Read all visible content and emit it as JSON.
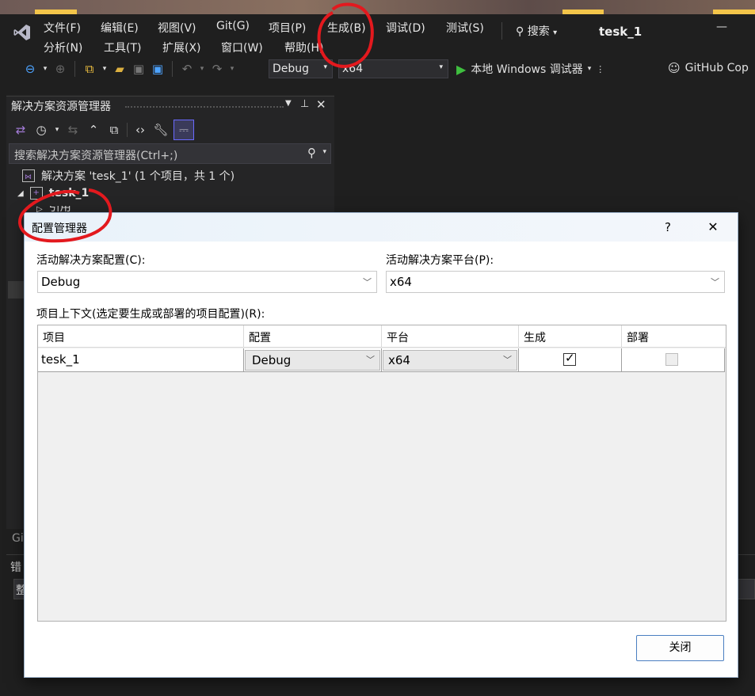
{
  "menu": {
    "row1": [
      "文件(F)",
      "编辑(E)",
      "视图(V)",
      "Git(G)",
      "项目(P)",
      "生成(B)",
      "调试(D)",
      "测试(S)"
    ],
    "row2": [
      "分析(N)",
      "工具(T)",
      "扩展(X)",
      "窗口(W)",
      "帮助(H)"
    ],
    "search_label": "搜索",
    "window_title": "tesk_1",
    "minimize": "—"
  },
  "toolbar": {
    "config_value": "Debug",
    "platform_value": "x64",
    "run_label": "本地 Windows 调试器",
    "copilot_label": "GitHub Cop"
  },
  "solution_explorer": {
    "title": "解决方案资源管理器",
    "search_placeholder": "搜索解决方案资源管理器(Ctrl+;)",
    "solution_node": "解决方案 'tesk_1' (1 个项目，共 1 个)",
    "project_node": "tesk_1",
    "references_node": "引用"
  },
  "background_fragments": {
    "git_label": "Gi",
    "error_label": "错",
    "whole_label": "整"
  },
  "dialog": {
    "title": "配置管理器",
    "help": "?",
    "close_x": "✕",
    "active_config_label": "活动解决方案配置(C):",
    "active_config_value": "Debug",
    "active_platform_label": "活动解决方案平台(P):",
    "active_platform_value": "x64",
    "context_label": "项目上下文(选定要生成或部署的项目配置)(R):",
    "grid": {
      "headers": [
        "项目",
        "配置",
        "平台",
        "生成",
        "部署"
      ],
      "rows": [
        {
          "project": "tesk_1",
          "config": "Debug",
          "platform": "x64",
          "build": true,
          "deploy": false
        }
      ]
    },
    "close_button": "关闭"
  },
  "colors": {
    "accent": "#0e639c",
    "annotation": "#e3191e",
    "run_green": "#3fbf3f"
  }
}
